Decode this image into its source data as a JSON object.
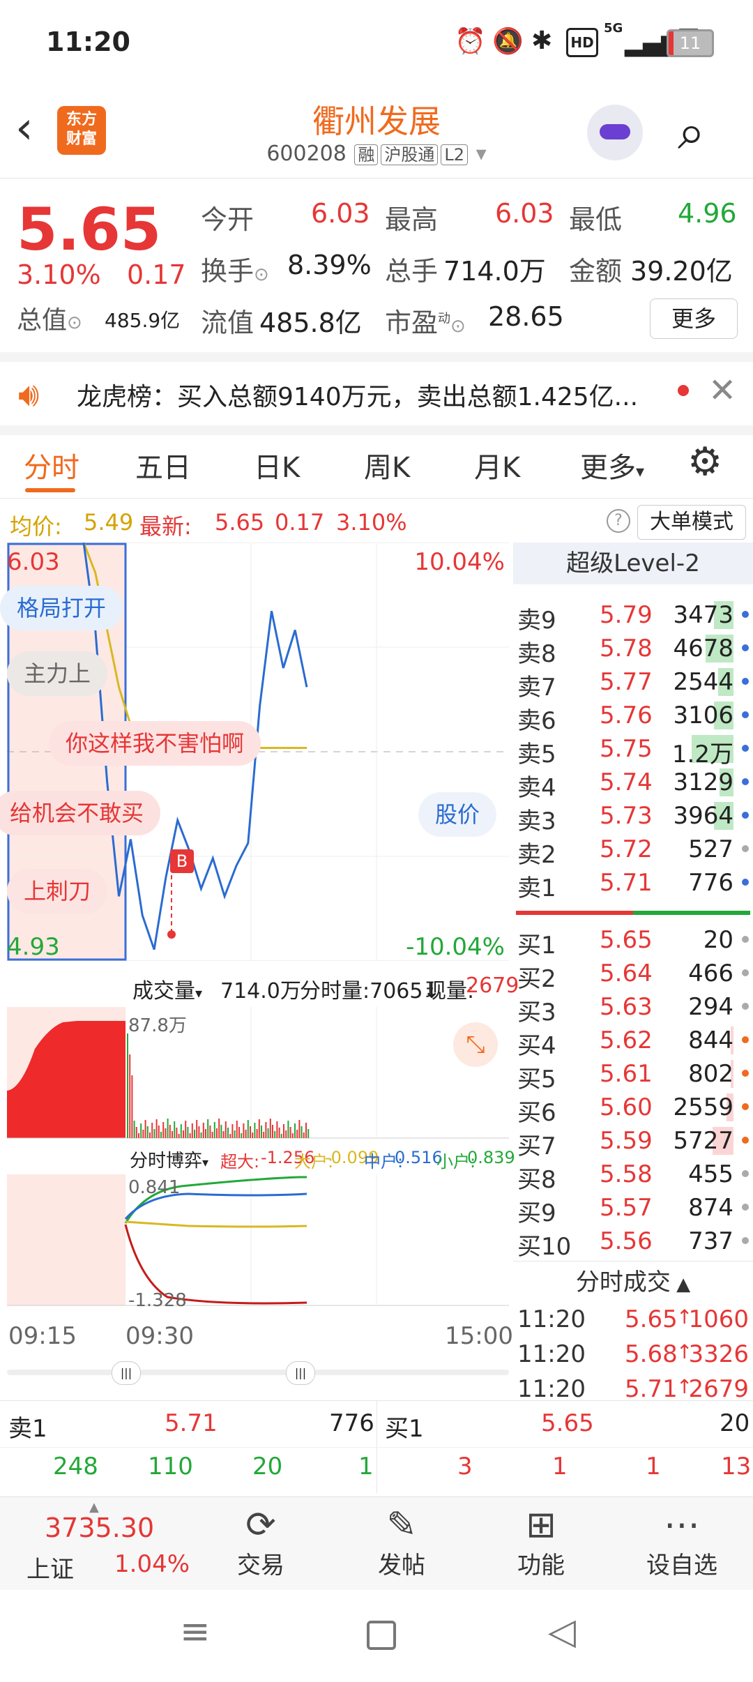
{
  "status": {
    "time": "11:20",
    "battery": "11",
    "network": "5G"
  },
  "header": {
    "back": "‹",
    "logo_line1": "东方",
    "logo_line2": "财富",
    "name": "衢州发展",
    "code": "600208",
    "tag1": "融",
    "tag2": "沪股通",
    "tag3": "L2"
  },
  "quote": {
    "price": "5.65",
    "pct": "3.10%",
    "chg": "0.17",
    "open_label": "今开",
    "open": "6.03",
    "high_label": "最高",
    "high": "6.03",
    "low_label": "最低",
    "low": "4.96",
    "turnover_label": "换手",
    "turnover": "8.39%",
    "volume_label": "总手",
    "volume": "714.0万",
    "amount_label": "金额",
    "amount": "39.20亿",
    "mktcap_label": "总值",
    "mktcap": "485.9亿",
    "float_label": "流值",
    "float": "485.8亿",
    "pe_label": "市盈",
    "pe_super": "动",
    "pe": "28.65",
    "more": "更多"
  },
  "dragon": {
    "text": "龙虎榜：买入总额9140万元，卖出总额1.425亿...",
    "close": "✕"
  },
  "tabs": [
    "分时",
    "五日",
    "日K",
    "周K",
    "月K",
    "更多"
  ],
  "avg": {
    "avg_label": "均价:",
    "avg_value": "5.49",
    "new_label": "最新:",
    "new_value": "5.65",
    "new_chg": "0.17",
    "new_pct": "3.10%",
    "bigmode": "大单模式"
  },
  "chart": {
    "top_left": "6.03",
    "top_right": "10.04%",
    "bottom_left": "4.93",
    "bottom_right": "-10.04%",
    "bubbles": [
      "格局打开",
      "主力上",
      "你这样我不害怕啊",
      "给机会不敢买",
      "上刺刀",
      "股价"
    ],
    "vol_label": "成交量",
    "vol_total": "714.0万",
    "vol_min": "分时量:7065↓",
    "vol_now_label": "现量:",
    "vol_now": "2679",
    "vol_max": "87.8万",
    "game_label": "分时博弈",
    "game_super": "超大:",
    "game_super_v": "-1.256",
    "game_large": "大户:",
    "game_large_v": "-0.099",
    "game_mid": "中户:",
    "game_mid_v": "0.516",
    "game_small": "小户:",
    "game_small_v": "0.839",
    "game_top": "0.841",
    "game_bottom": "-1.328",
    "time_start": "09:15",
    "time_mid": "09:30",
    "time_end": "15:00"
  },
  "chart_data": {
    "type": "line",
    "title": "",
    "xlabel": "",
    "ylabel": "",
    "ylim": [
      4.93,
      6.03
    ],
    "series": [
      {
        "values": [
          6.03,
          5.8,
          5.4,
          5.1,
          5.25,
          5.05,
          4.96,
          5.15,
          5.3,
          5.22,
          5.12,
          5.2,
          5.1,
          5.18,
          5.24,
          5.6,
          5.85,
          5.7,
          5.8,
          5.65
        ]
      },
      {
        "values": [
          6.03,
          5.95,
          5.8,
          5.65,
          5.55,
          5.5,
          5.48,
          5.47,
          5.47,
          5.47,
          5.48,
          5.48,
          5.48,
          5.49,
          5.49,
          5.49,
          5.49,
          5.49,
          5.49,
          5.49
        ]
      }
    ]
  },
  "level2": {
    "title": "超级Level-2",
    "asks": [
      {
        "label": "卖9",
        "price": "5.79",
        "vol": "3473"
      },
      {
        "label": "卖8",
        "price": "5.78",
        "vol": "4678"
      },
      {
        "label": "卖7",
        "price": "5.77",
        "vol": "2544"
      },
      {
        "label": "卖6",
        "price": "5.76",
        "vol": "3106"
      },
      {
        "label": "卖5",
        "price": "5.75",
        "vol": "1.2万"
      },
      {
        "label": "卖4",
        "price": "5.74",
        "vol": "3129"
      },
      {
        "label": "卖3",
        "price": "5.73",
        "vol": "3964"
      },
      {
        "label": "卖2",
        "price": "5.72",
        "vol": "527"
      },
      {
        "label": "卖1",
        "price": "5.71",
        "vol": "776"
      }
    ],
    "bids": [
      {
        "label": "买1",
        "price": "5.65",
        "vol": "20"
      },
      {
        "label": "买2",
        "price": "5.64",
        "vol": "466"
      },
      {
        "label": "买3",
        "price": "5.63",
        "vol": "294"
      },
      {
        "label": "买4",
        "price": "5.62",
        "vol": "844"
      },
      {
        "label": "买5",
        "price": "5.61",
        "vol": "802"
      },
      {
        "label": "买6",
        "price": "5.60",
        "vol": "2559"
      },
      {
        "label": "买7",
        "price": "5.59",
        "vol": "5727"
      },
      {
        "label": "买8",
        "price": "5.58",
        "vol": "455"
      },
      {
        "label": "买9",
        "price": "5.57",
        "vol": "874"
      },
      {
        "label": "买10",
        "price": "5.56",
        "vol": "737"
      }
    ],
    "ticks_title": "分时成交",
    "ticks": [
      {
        "time": "11:20",
        "price": "5.65",
        "vol": "1060"
      },
      {
        "time": "11:20",
        "price": "5.68",
        "vol": "3326"
      },
      {
        "time": "11:20",
        "price": "5.71",
        "vol": "2679"
      }
    ]
  },
  "quickbar": {
    "sell_label": "卖1",
    "sell_price": "5.71",
    "sell_vol": "776",
    "buy_label": "买1",
    "buy_price": "5.65",
    "buy_vol": "20",
    "sell_q": [
      "248",
      "110",
      "20",
      "1"
    ],
    "buy_q": [
      "3",
      "1",
      "1",
      "13"
    ]
  },
  "nav": {
    "index_value": "3735.30",
    "index_name": "上证",
    "index_pct": "1.04%",
    "trade": "交易",
    "post": "发帖",
    "func": "功能",
    "watch": "设自选"
  }
}
